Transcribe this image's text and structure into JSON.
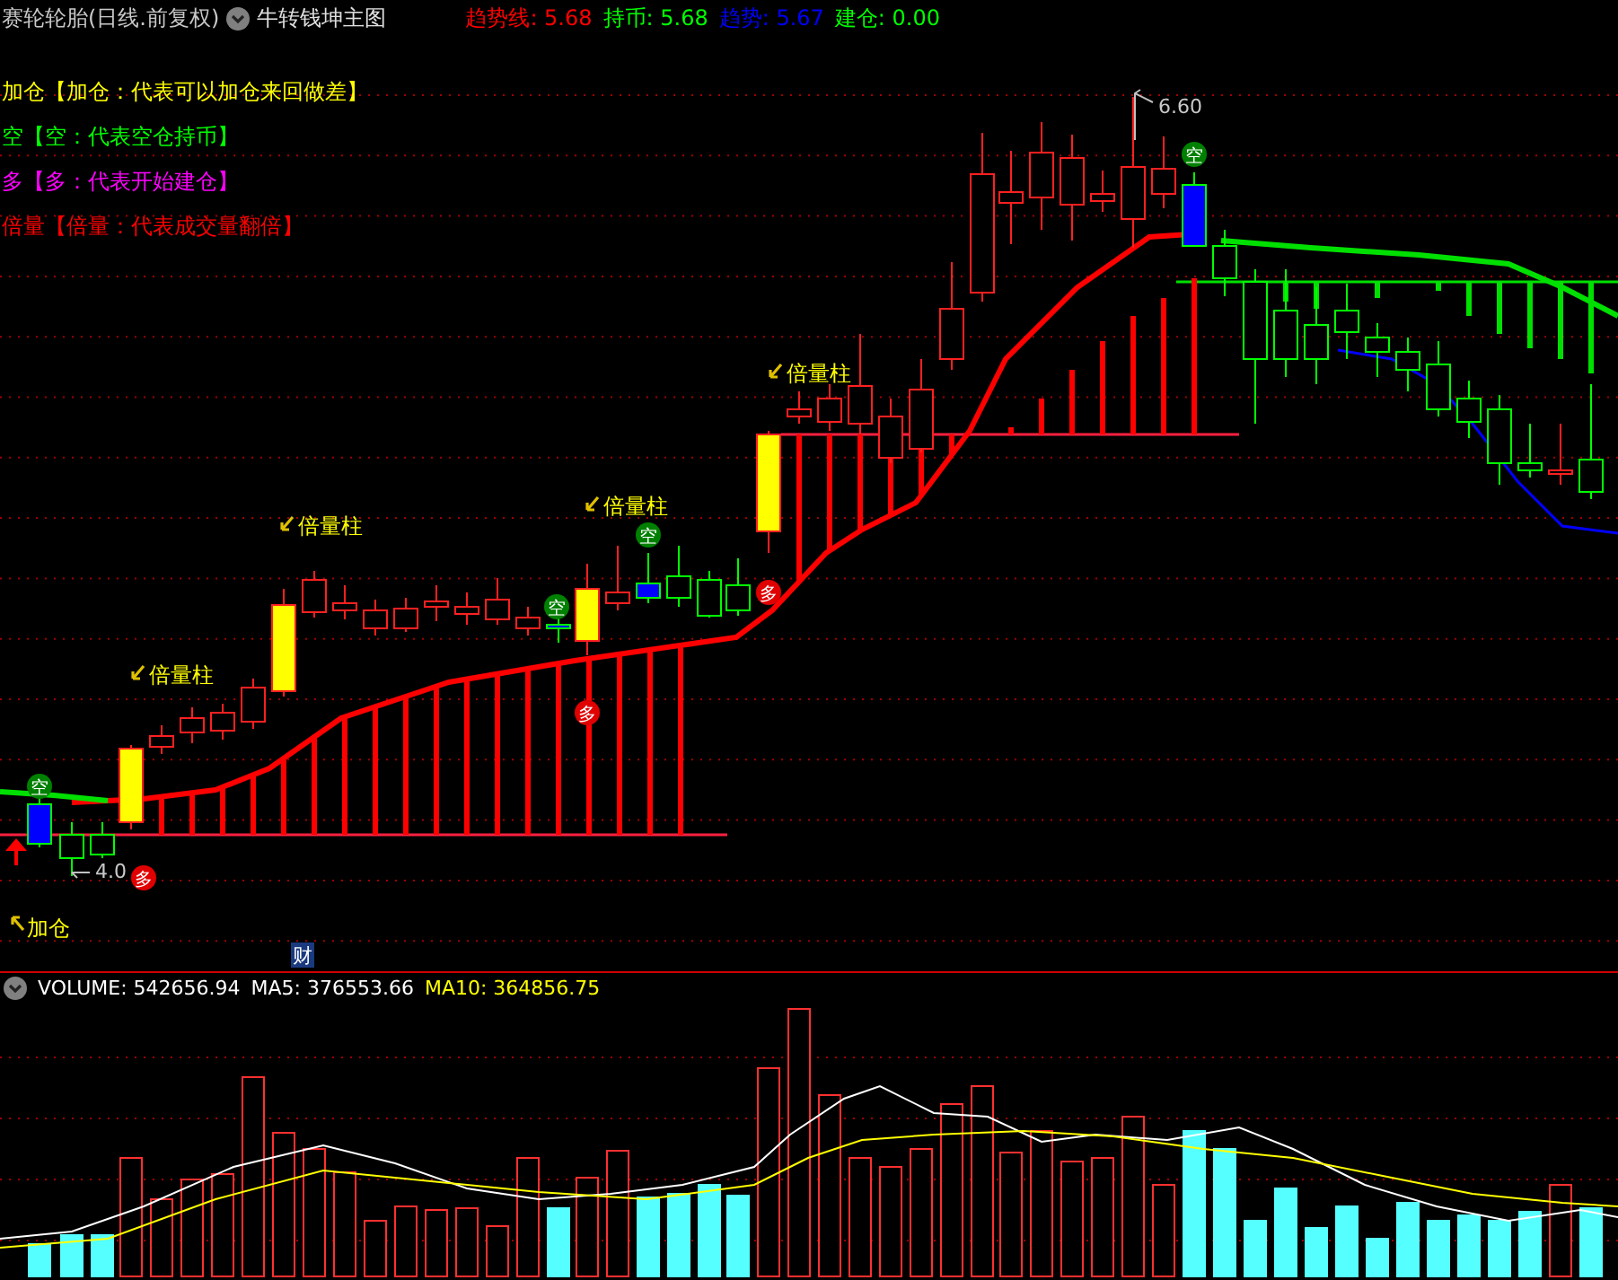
{
  "header": {
    "title": "赛轮轮胎(日线.前复权)",
    "indicator": "牛转钱坤主图",
    "readings": [
      {
        "label": "趋势线:",
        "value": "5.68",
        "color": "#ff0000"
      },
      {
        "label": "持币:",
        "value": "5.68",
        "color": "#00ff00"
      },
      {
        "label": "趋势:",
        "value": "5.67",
        "color": "#0000ff"
      },
      {
        "label": "建仓:",
        "value": "0.00",
        "color": "#00ff00"
      }
    ]
  },
  "legend": [
    {
      "text": "加仓【加仓：代表可以加仓来回做差】",
      "color": "#ffff00"
    },
    {
      "text": "空【空：代表空仓持币】",
      "color": "#00ff00"
    },
    {
      "text": "多【多：代表开始建仓】",
      "color": "#ff00ff"
    },
    {
      "text": "倍量【倍量：代表成交量翻倍】",
      "color": "#ff0000"
    }
  ],
  "annotations": [
    {
      "kind": "double-volume",
      "text": "倍量柱"
    },
    {
      "kind": "double-volume",
      "text": "倍量柱"
    },
    {
      "kind": "double-volume",
      "text": "倍量柱"
    },
    {
      "kind": "double-volume",
      "text": "倍量柱"
    },
    {
      "kind": "add-position",
      "text": "加仓"
    },
    {
      "kind": "high-price",
      "text": "6.60"
    },
    {
      "kind": "low-price",
      "text": "4.0"
    },
    {
      "kind": "news",
      "text": "财"
    }
  ],
  "markers": [
    {
      "kind": "empty",
      "text": "空"
    },
    {
      "kind": "empty",
      "text": "空"
    },
    {
      "kind": "empty",
      "text": "空"
    },
    {
      "kind": "empty",
      "text": "空"
    },
    {
      "kind": "long",
      "text": "多"
    },
    {
      "kind": "long",
      "text": "多"
    },
    {
      "kind": "long",
      "text": "多"
    }
  ],
  "volume": {
    "readings": [
      {
        "label": "VOLUME:",
        "value": "542656.94",
        "color": "#ffffff"
      },
      {
        "label": "MA5:",
        "value": "376553.66",
        "color": "#ffffff"
      },
      {
        "label": "MA10:",
        "value": "364856.75",
        "color": "#ffff00"
      }
    ]
  }
}
